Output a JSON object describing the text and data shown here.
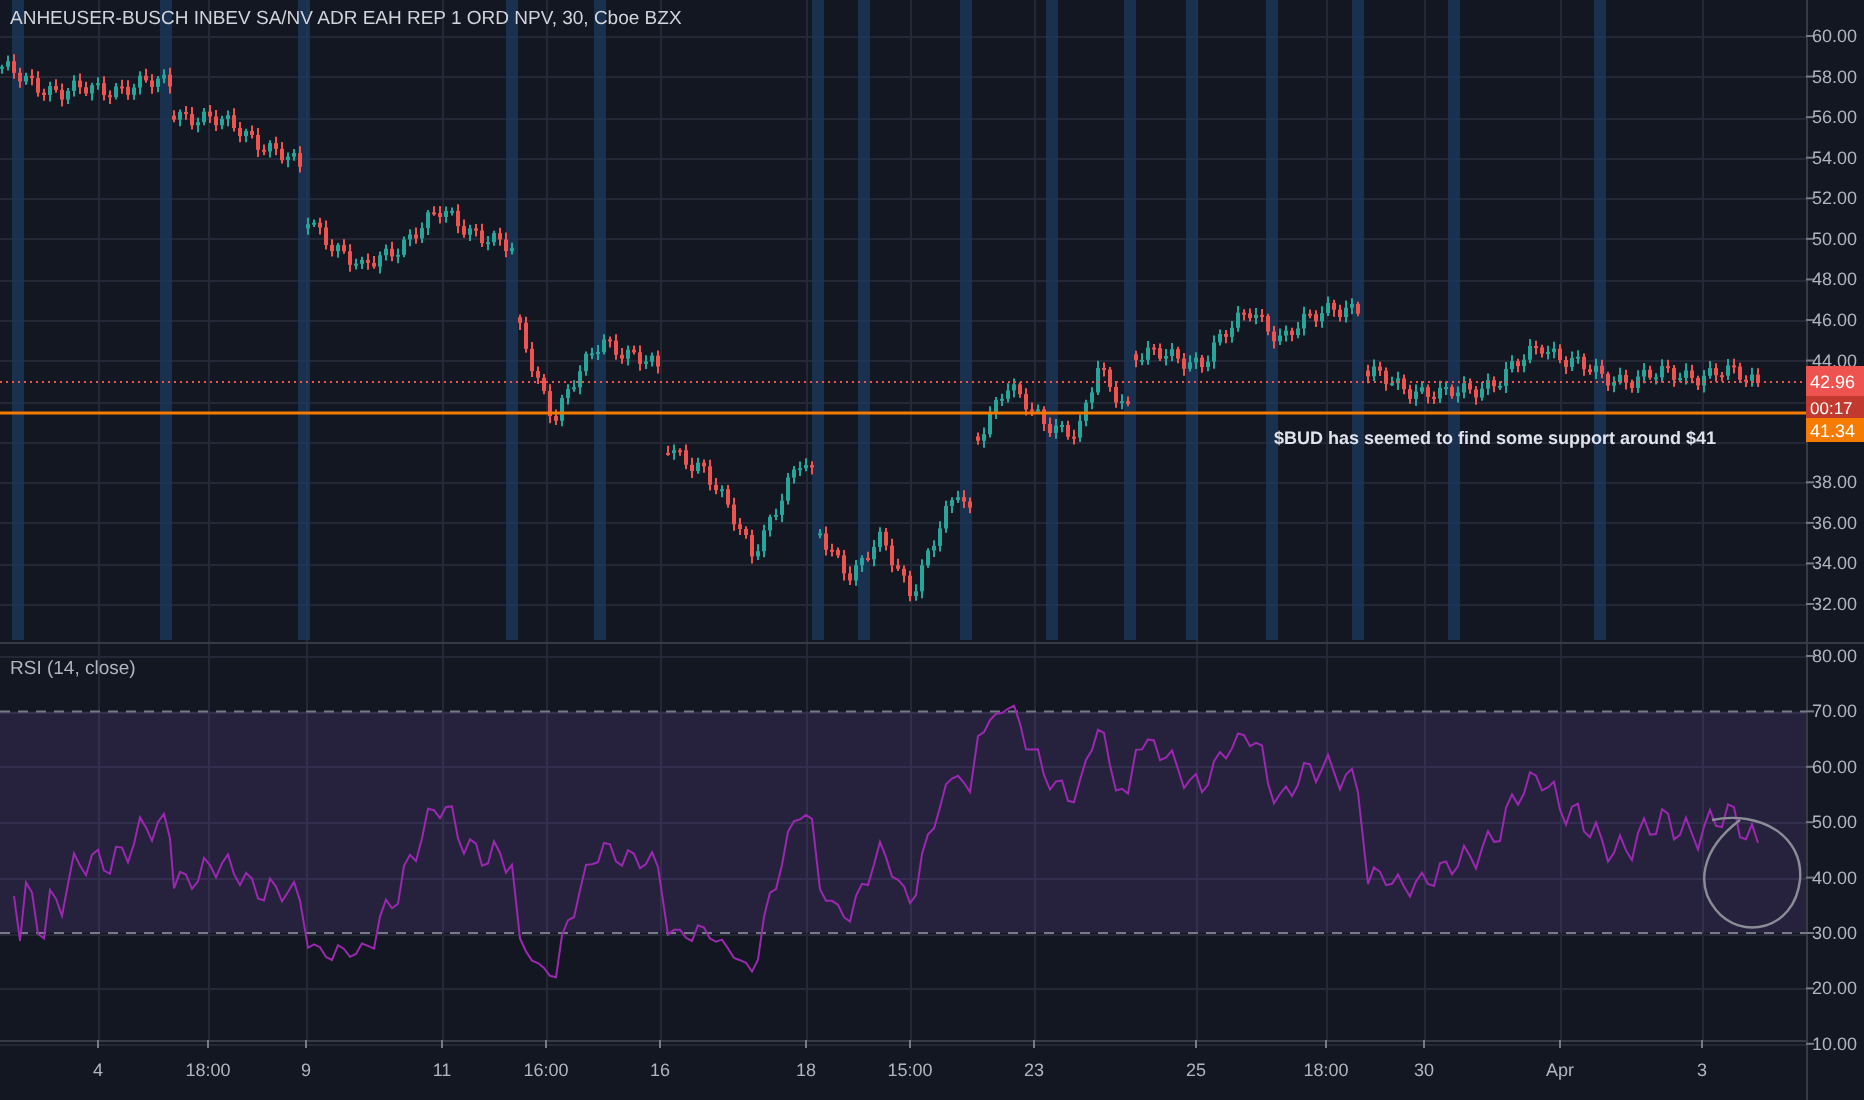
{
  "chart": {
    "title": "ANHEUSER-BUSCH INBEV SA/NV ADR EAH REP 1 ORD NPV, 30, Cboe BZX",
    "annotation": "$BUD has seemed to find some support around $41"
  },
  "price_axis": {
    "ticks": [
      "60.00",
      "58.00",
      "56.00",
      "54.00",
      "52.00",
      "50.00",
      "48.00",
      "46.00",
      "44.00",
      "38.00",
      "36.00",
      "34.00",
      "32.00"
    ],
    "last_price": "42.96",
    "countdown": "00:17",
    "level_price": "41.34"
  },
  "rsi_pane": {
    "label": "RSI (14, close)",
    "ticks": [
      "80.00",
      "70.00",
      "60.00",
      "50.00",
      "40.00",
      "30.00",
      "20.00",
      "10.00"
    ]
  },
  "time_axis": {
    "labels": [
      "4",
      "18:00",
      "9",
      "11",
      "16:00",
      "16",
      "18",
      "15:00",
      "23",
      "25",
      "18:00",
      "30",
      "Apr",
      "3"
    ]
  }
}
